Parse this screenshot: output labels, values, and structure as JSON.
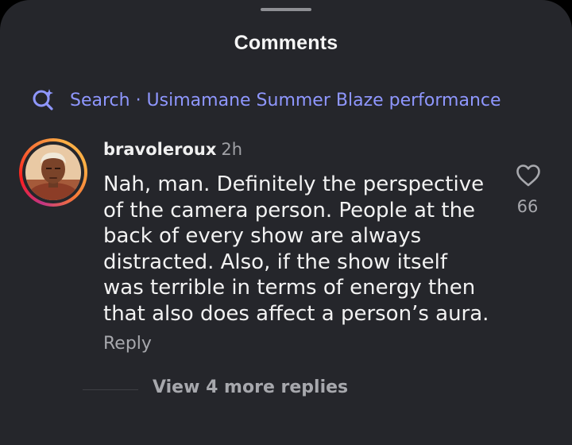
{
  "sheet": {
    "title": "Comments"
  },
  "search": {
    "text": "Search · Usimamane Summer Blaze performance",
    "icon": "search-sparkle-icon",
    "color": "#8f97ff"
  },
  "comment": {
    "username": "bravoleroux",
    "time": "2h",
    "text": "Nah, man. Definitely the perspective\nof the camera person. People at the\nback of every show are always\ndistracted. Also, if the show itself\nwas terrible in terms of energy then\nthat also does affect a person’s aura.",
    "reply_label": "Reply",
    "like_icon": "heart-outline-icon",
    "like_count": "66",
    "view_replies_label": "View 4 more replies"
  },
  "colors": {
    "background": "#25262b",
    "text": "#f2f2f2",
    "muted": "#a7a8ad"
  }
}
